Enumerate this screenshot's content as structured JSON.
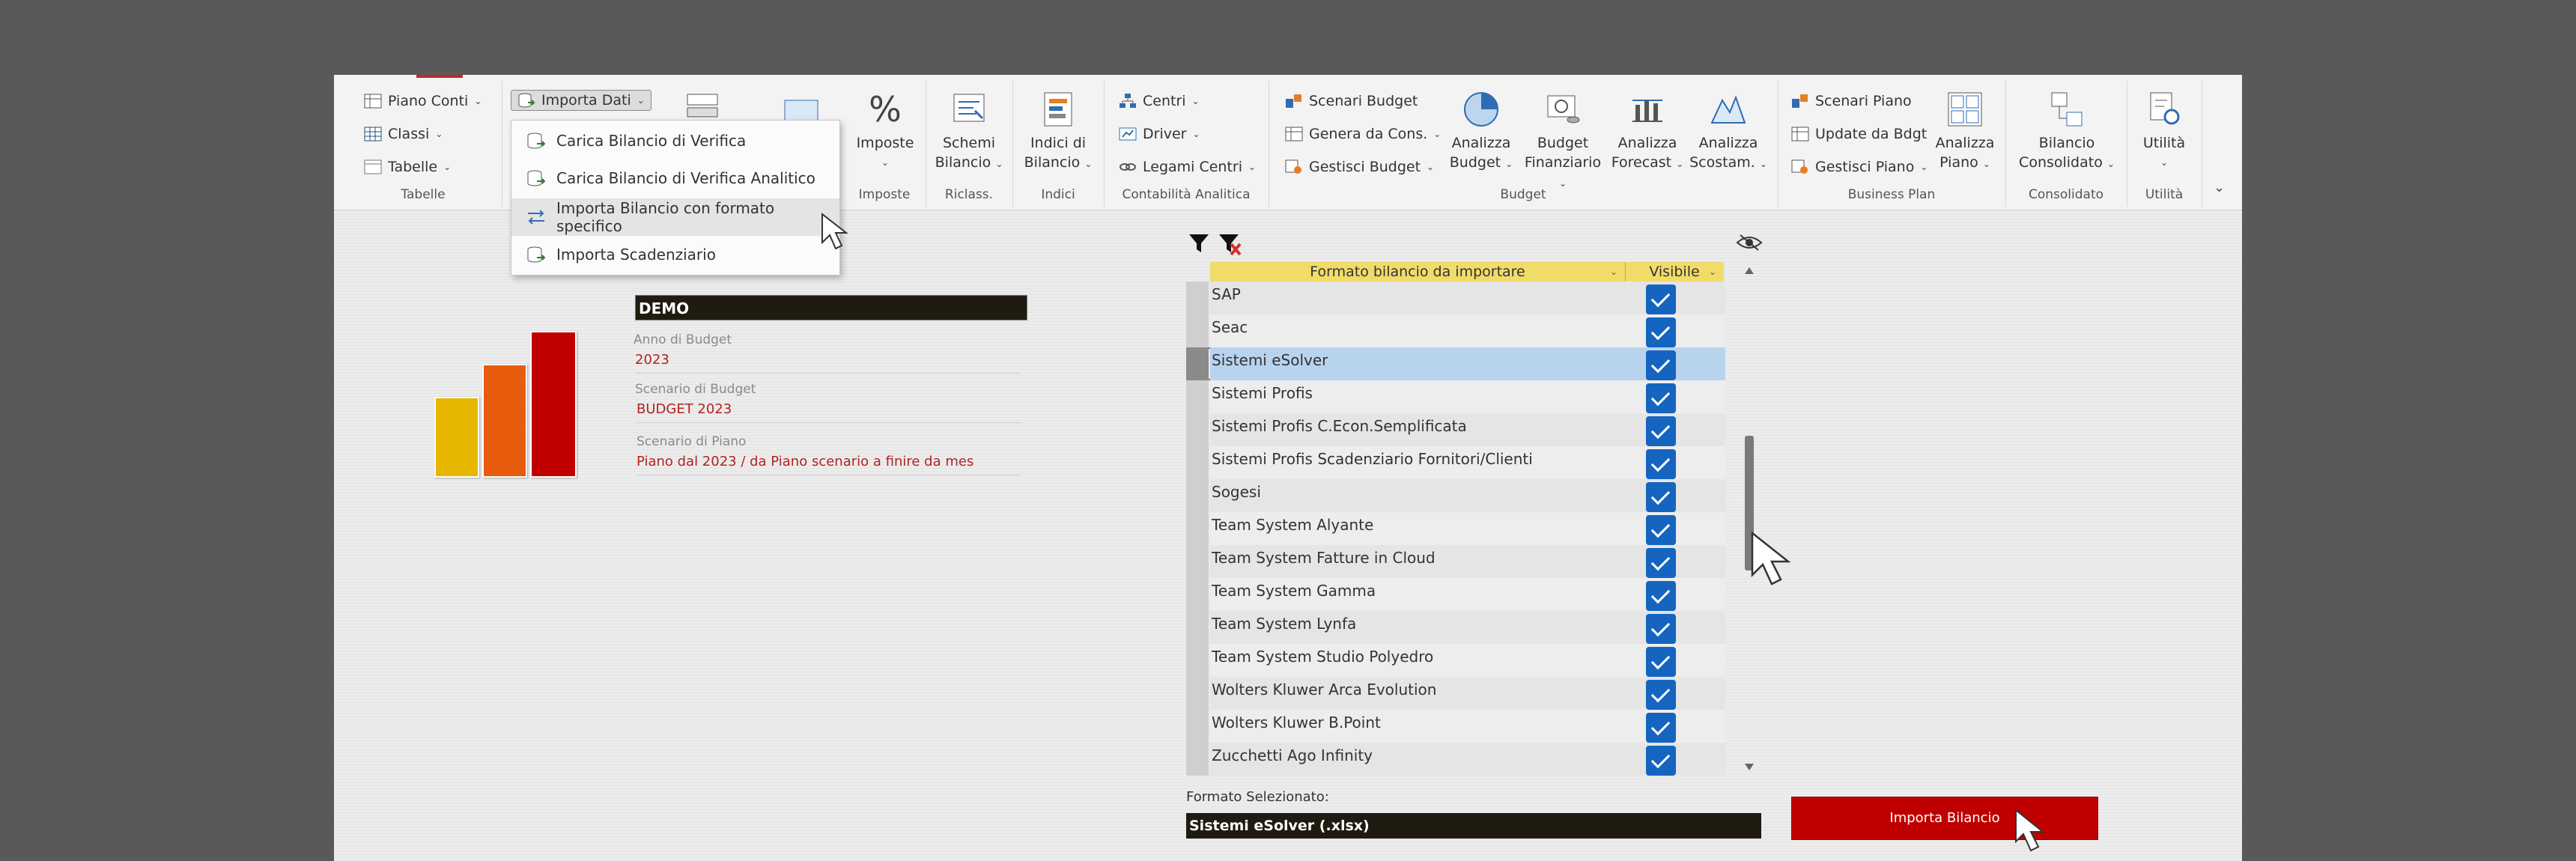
{
  "ribbon": {
    "tabelle": {
      "piano_conti": "Piano Conti",
      "classi": "Classi",
      "tabelle": "Tabelle",
      "group": "Tabelle"
    },
    "importa_dati": "Importa Dati",
    "imposte": {
      "label1": "Imposte",
      "group": "Imposte"
    },
    "riclass": {
      "label1": "Schemi",
      "label2": "Bilancio",
      "group": "Riclass."
    },
    "indici": {
      "label1": "Indici di",
      "label2": "Bilancio",
      "group": "Indici"
    },
    "contabilita": {
      "centri": "Centri",
      "driver": "Driver",
      "legami": "Legami Centri",
      "group": "Contabilità Analitica"
    },
    "budget": {
      "scenari": "Scenari Budget",
      "genera": "Genera da Cons.",
      "gestisci": "Gestisci Budget",
      "analizza1": "Analizza",
      "analizza2": "Budget",
      "fin1": "Budget",
      "fin2": "Finanziario",
      "forecast1": "Analizza",
      "forecast2": "Forecast",
      "scost1": "Analizza",
      "scost2": "Scostam.",
      "group": "Budget"
    },
    "business": {
      "scenari": "Scenari Piano",
      "update": "Update da Bdgt",
      "gestisci": "Gestisci Piano",
      "analizza1": "Analizza",
      "analizza2": "Piano",
      "group": "Business Plan"
    },
    "consolidato": {
      "label1": "Bilancio",
      "label2": "Consolidato",
      "group": "Consolidato"
    },
    "utilita": {
      "label1": "Utilità",
      "group": "Utilità"
    }
  },
  "menu": [
    "Carica Bilancio di Verifica",
    "Carica Bilancio di Verifica Analitico",
    "Importa Bilancio con formato specifico",
    "Importa Scadenziario"
  ],
  "info": {
    "company": "DEMO",
    "anno_label": "Anno di Budget",
    "anno_value": "2023",
    "scenario_label": "Scenario di Budget",
    "scenario_value": "BUDGET 2023",
    "piano_label": "Scenario di Piano",
    "piano_value": "Piano dal 2023 / da Piano scenario a finire da mes"
  },
  "table": {
    "col1": "Formato bilancio da importare",
    "col2": "Visibile",
    "rows": [
      "SAP",
      "Seac",
      "Sistemi eSolver",
      "Sistemi Profis",
      "Sistemi Profis C.Econ.Semplificata",
      "Sistemi Profis Scadenziario Fornitori/Clienti",
      "Sogesi",
      "Team System Alyante",
      "Team System Fatture in Cloud",
      "Team System Gamma",
      "Team System Lynfa",
      "Team System Studio Polyedro",
      "Wolters Kluwer Arca Evolution",
      "Wolters Kluwer B.Point",
      "Zucchetti  Ago Infinity"
    ],
    "selected_index": 2
  },
  "format": {
    "label": "Formato Selezionato:",
    "value": "Sistemi eSolver  (.xlsx)"
  },
  "import_button": "Importa Bilancio",
  "colors": {
    "accent_red": "#c00000",
    "header_yellow": "#f1dc6a",
    "check_blue": "#1565c0"
  }
}
